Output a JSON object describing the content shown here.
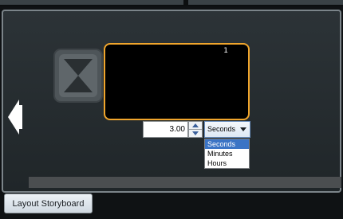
{
  "frame": {
    "number": "1"
  },
  "duration": {
    "value": "3.00",
    "unit": "Seconds",
    "options": [
      "Seconds",
      "Minutes",
      "Hours"
    ],
    "selected_option": "Seconds"
  },
  "footer": {
    "storyboard_button": "Layout Storyboard"
  },
  "colors": {
    "frame_border": "#f0a52c",
    "dropdown_highlight": "#3b74c5",
    "panel_border": "#7b8489"
  },
  "icons": {
    "hourglass": "hourglass-icon",
    "previous": "arrow-left-icon",
    "spin_up": "caret-up-icon",
    "spin_down": "caret-down-icon",
    "dropdown": "chevron-down-icon"
  }
}
